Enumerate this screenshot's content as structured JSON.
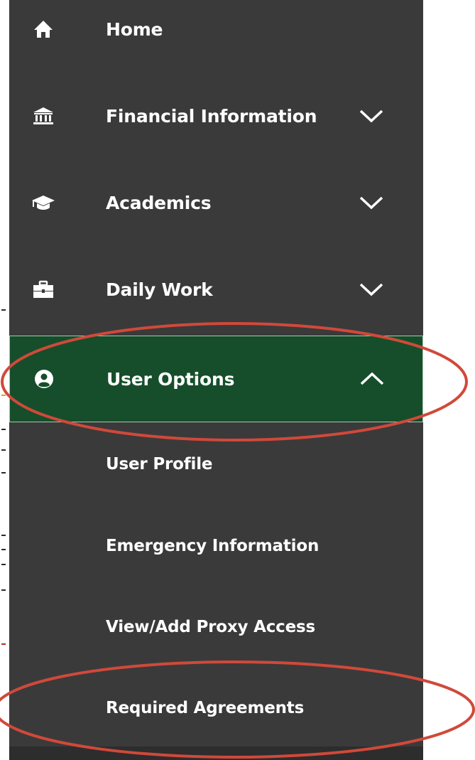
{
  "nav": {
    "items": [
      {
        "label": "Home",
        "icon": "home-icon",
        "expandable": false
      },
      {
        "label": "Financial Information",
        "icon": "bank-icon",
        "expandable": true,
        "expanded": false
      },
      {
        "label": "Academics",
        "icon": "graduation-cap-icon",
        "expandable": true,
        "expanded": false
      },
      {
        "label": "Daily Work",
        "icon": "briefcase-icon",
        "expandable": true,
        "expanded": false
      },
      {
        "label": "User Options",
        "icon": "user-circle-icon",
        "expandable": true,
        "expanded": true,
        "active": true
      }
    ],
    "user_options_sub": [
      {
        "label": "User Profile"
      },
      {
        "label": "Emergency Information"
      },
      {
        "label": "View/Add Proxy Access"
      },
      {
        "label": "Required Agreements"
      }
    ]
  },
  "colors": {
    "sidebar_bg": "#3a3a3a",
    "active_bg": "#164e2b",
    "text": "#ffffff",
    "annotation_ellipse": "#d0493a"
  }
}
